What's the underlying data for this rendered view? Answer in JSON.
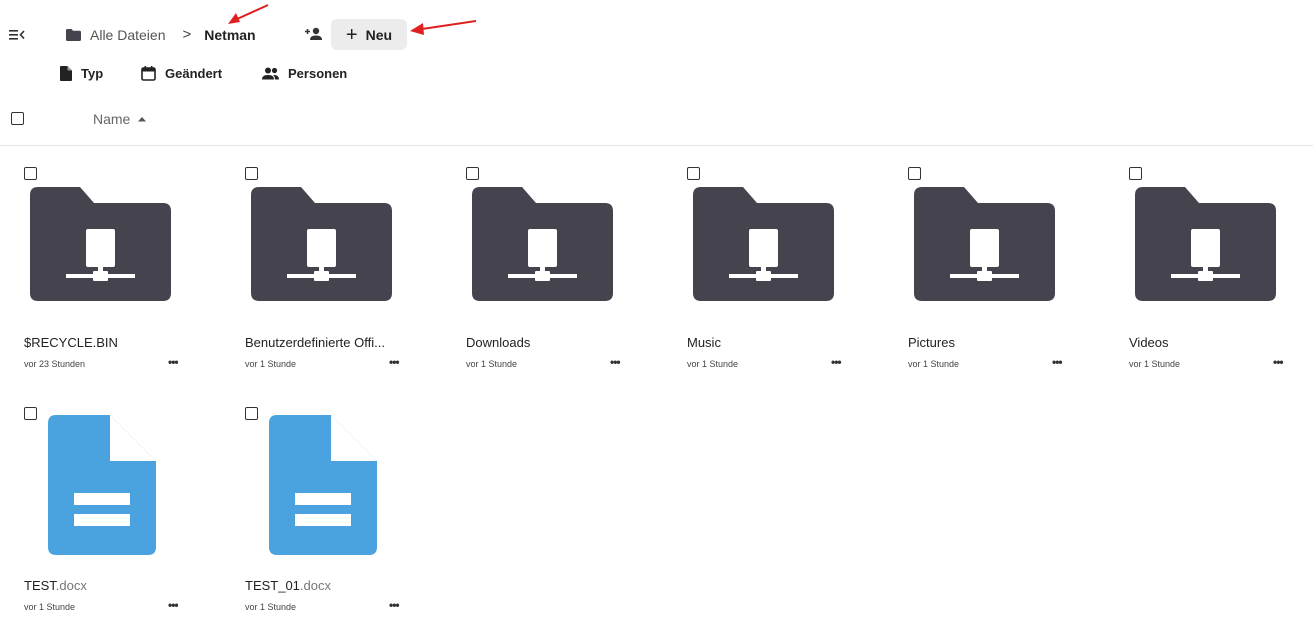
{
  "colors": {
    "folder": "#45434d",
    "doc": "#4aa3df",
    "arrow": "#e02020"
  },
  "header": {
    "nav_toggle_icon": "menu-collapse-icon",
    "breadcrumb": {
      "root_icon": "folder-icon",
      "root_label": "Alle Dateien",
      "separator": ">",
      "current_label": "Netman"
    },
    "share_icon": "add-person-icon",
    "new_button": {
      "icon": "+",
      "label": "Neu"
    }
  },
  "filters": [
    {
      "icon": "file-icon",
      "label": "Typ"
    },
    {
      "icon": "calendar-icon",
      "label": "Geändert"
    },
    {
      "icon": "people-icon",
      "label": "Personen"
    }
  ],
  "list_header": {
    "sort_label": "Name",
    "sort_direction_icon": "sort-ascending-icon"
  },
  "files": [
    {
      "type": "folder",
      "name": "$RECYCLE.BIN",
      "ext": "",
      "modified": "vor 23 Stunden",
      "more": "•••"
    },
    {
      "type": "folder",
      "name": "Benutzerdefinierte Offi...",
      "ext": "",
      "modified": "vor 1 Stunde",
      "more": "•••"
    },
    {
      "type": "folder",
      "name": "Downloads",
      "ext": "",
      "modified": "vor 1 Stunde",
      "more": "•••"
    },
    {
      "type": "folder",
      "name": "Music",
      "ext": "",
      "modified": "vor 1 Stunde",
      "more": "•••"
    },
    {
      "type": "folder",
      "name": "Pictures",
      "ext": "",
      "modified": "vor 1 Stunde",
      "more": "•••"
    },
    {
      "type": "folder",
      "name": "Videos",
      "ext": "",
      "modified": "vor 1 Stunde",
      "more": "•••"
    },
    {
      "type": "document",
      "name": "TEST",
      "ext": ".docx",
      "modified": "vor 1 Stunde",
      "more": "•••"
    },
    {
      "type": "document",
      "name": "TEST_01",
      "ext": ".docx",
      "modified": "vor 1 Stunde",
      "more": "•••"
    }
  ]
}
